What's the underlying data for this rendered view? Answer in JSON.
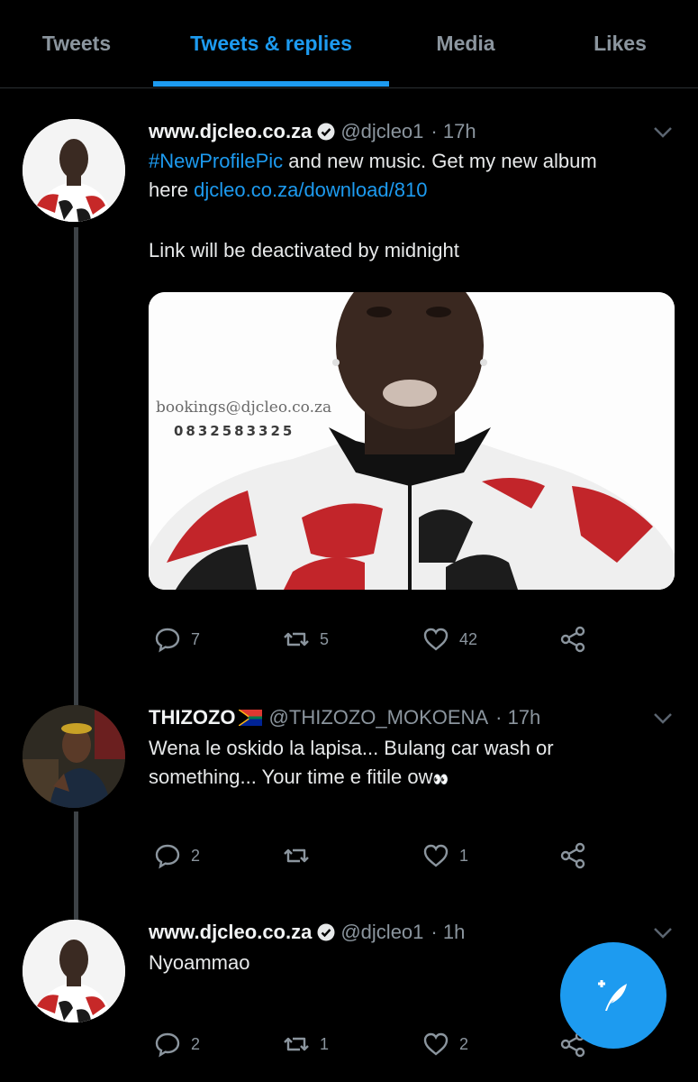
{
  "tabs": [
    {
      "label": "Tweets"
    },
    {
      "label": "Tweets & replies"
    },
    {
      "label": "Media"
    },
    {
      "label": "Likes"
    }
  ],
  "tweets": [
    {
      "name": "www.djcleo.co.za",
      "handle": "@djcleo1",
      "time": "· 17h",
      "text_hashtag": "#NewProfilePic",
      "text_part1": " and new music. Get my new album",
      "text_part2": "here ",
      "text_link": "djcleo.co.za/download/810",
      "text_line3": "Link will be deactivated by midnight",
      "media_email": "bookings@djcleo.co.za",
      "media_phone": "0832583325",
      "replies": "7",
      "retweets": "5",
      "likes": "42"
    },
    {
      "name": "THIZOZO",
      "handle": "@THIZOZO_MOKOENA",
      "time": "· 17h",
      "text_line1": "Wena le oskido la lapisa... Bulang car wash or",
      "text_line2": "something... Your time e fitile ow",
      "emoji": "👀",
      "replies": "2",
      "retweets": "",
      "likes": "1"
    },
    {
      "name": "www.djcleo.co.za",
      "handle": "@djcleo1",
      "time": "· 1h",
      "text_line1": "Nyoammao",
      "replies": "2",
      "retweets": "1",
      "likes": "2"
    }
  ],
  "icons": [
    "verified-icon",
    "chevron-down-icon",
    "reply-icon",
    "retweet-icon",
    "like-icon",
    "share-icon",
    "compose-icon",
    "south-africa-flag-icon"
  ],
  "colors": {
    "accent": "#1d9bf0",
    "background": "#000000",
    "muted": "#8b959e"
  }
}
